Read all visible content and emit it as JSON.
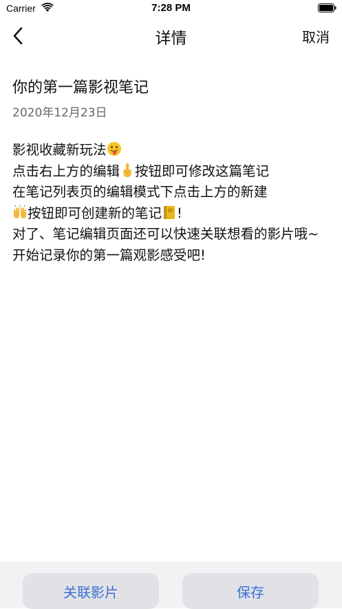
{
  "status_bar": {
    "carrier": "Carrier",
    "time": "7:28 PM"
  },
  "nav": {
    "title": "详情",
    "cancel_label": "取消"
  },
  "note": {
    "title": "你的第一篇影视笔记",
    "date": "2020年12月23日",
    "body": {
      "line1": "影视收藏新玩法",
      "line2a": "点击右上方的编辑",
      "line2b": "按钮即可修改这篇笔记",
      "line3": "在笔记列表页的编辑模式下点击上方的新建",
      "line4a": "按钮即可创建新的笔记",
      "line4b": "!",
      "line5": "对了、笔记编辑页面还可以快速关联想看的影片哦~",
      "line6": "开始记录你的第一篇观影感受吧!"
    }
  },
  "toolbar": {
    "link_movie_label": "关联影片",
    "save_label": "保存"
  },
  "colors": {
    "accent": "#3b6fd6",
    "toolbar_bg": "#f2f2f4",
    "button_bg": "#e2e2e6",
    "date_text": "#666666"
  },
  "icons": [
    "wifi-icon",
    "battery-icon",
    "back-chevron-icon",
    "tongue-out-emoji-icon",
    "pointing-up-emoji-icon",
    "raised-hands-emoji-icon",
    "notebook-emoji-icon"
  ]
}
